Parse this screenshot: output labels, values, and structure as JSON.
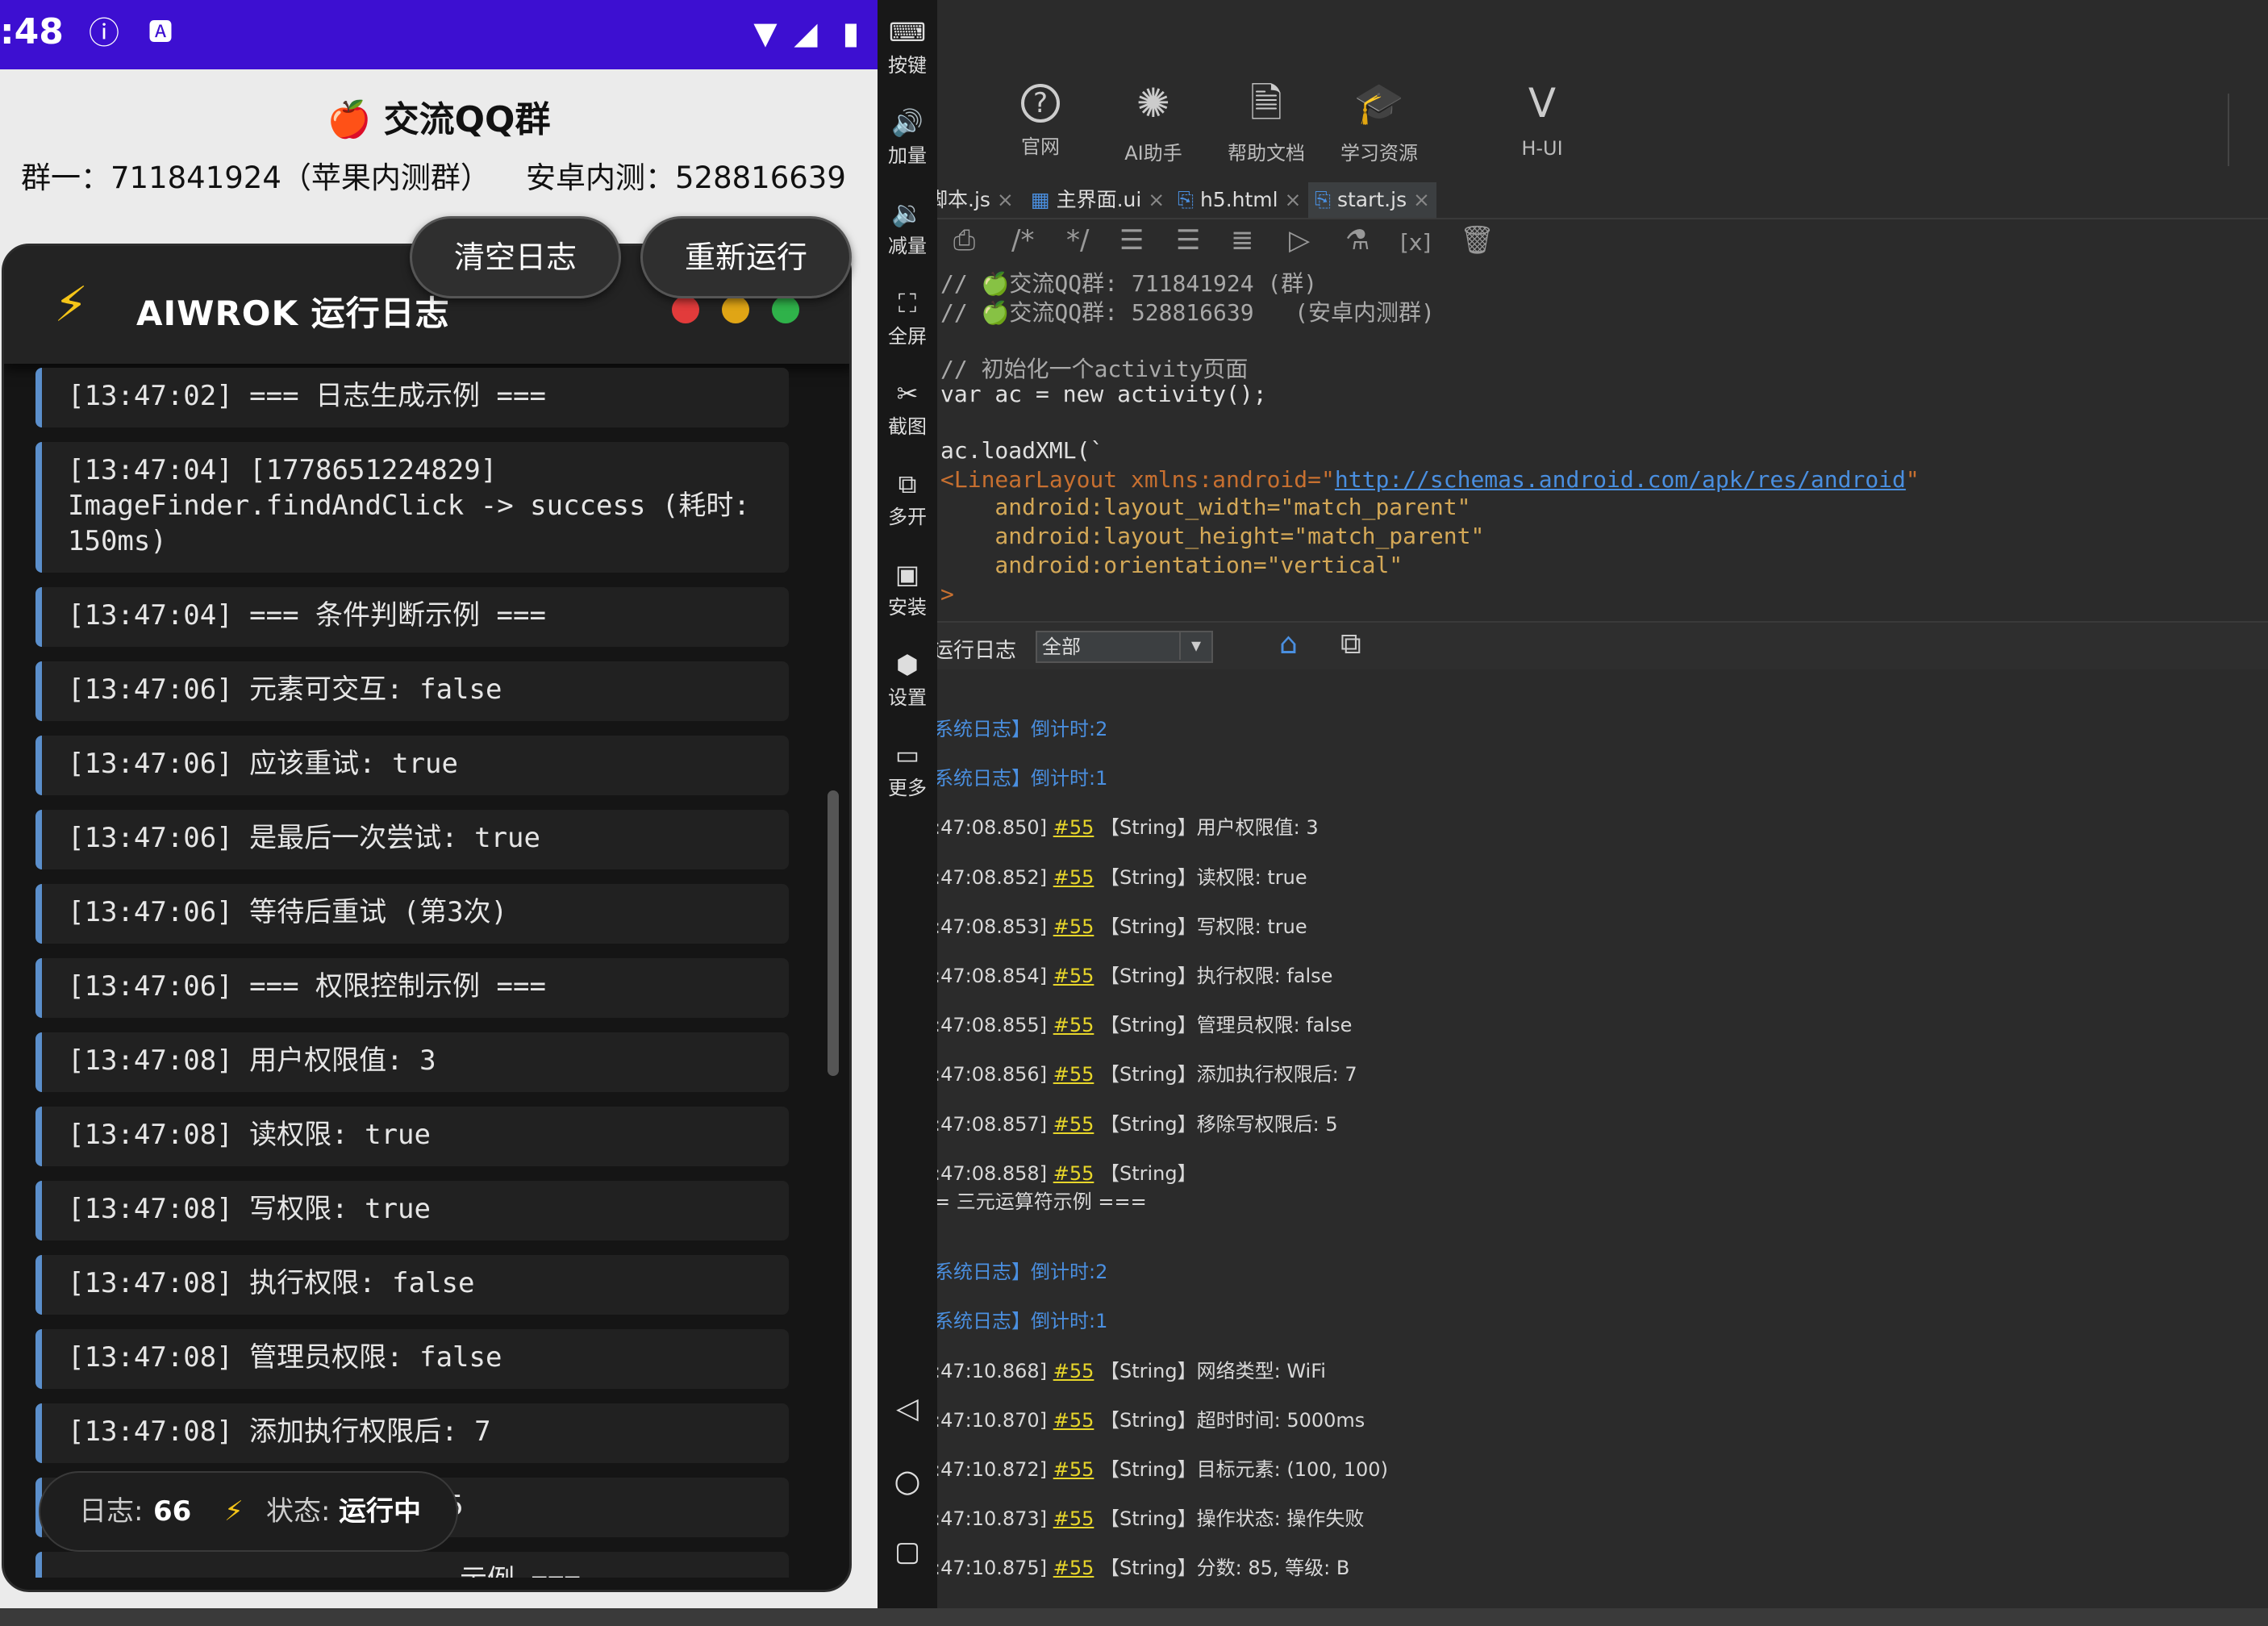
{
  "phone": {
    "status_time": ":48",
    "qq": {
      "title": "🍎 交流QQ群",
      "group1": "群一：711841924（苹果内测群）",
      "group2": "安卓内测：528816639"
    },
    "panel": {
      "title": "AIWROK 运行日志",
      "clear_label": "清空日志",
      "rerun_label": "重新运行"
    },
    "entries": [
      "[13:47:02] === 日志生成示例 ===",
      "[13:47:04] [1778651224829]\nImageFinder.findAndClick -> success (耗时:\n150ms)",
      "[13:47:04] === 条件判断示例 ===",
      "[13:47:06] 元素可交互: false",
      "[13:47:06] 应该重试: true",
      "[13:47:06] 是最后一次尝试: true",
      "[13:47:06] 等待后重试 (第3次)",
      "[13:47:06] === 权限控制示例 ===",
      "[13:47:08] 用户权限值: 3",
      "[13:47:08] 读权限: true",
      "[13:47:08] 写权限: true",
      "[13:47:08] 执行权限: false",
      "[13:47:08] 管理员权限: false",
      "[13:47:08] 添加执行权限后: 7",
      "[13:47:08] 移除写权限后: 5",
      "示例 ==="
    ],
    "footer": {
      "log_label": "日志:",
      "log_count": "66",
      "status_label": "状态:",
      "status_value": "运行中"
    }
  },
  "sidebar": [
    {
      "icon": "keyboard-icon",
      "label": "按键"
    },
    {
      "icon": "volume-up-icon",
      "label": "加量"
    },
    {
      "icon": "volume-down-icon",
      "label": "减量"
    },
    {
      "icon": "fullscreen-icon",
      "label": "全屏"
    },
    {
      "icon": "scissors-icon",
      "label": "截图"
    },
    {
      "icon": "multi-open-icon",
      "label": "多开"
    },
    {
      "icon": "apk-icon",
      "label": "安装"
    },
    {
      "icon": "settings-icon",
      "label": "设置"
    },
    {
      "icon": "more-icon",
      "label": "更多"
    }
  ],
  "toolbar": [
    {
      "icon": "help-circle-icon",
      "label": "官网"
    },
    {
      "icon": "ai-icon",
      "label": "AI助手"
    },
    {
      "icon": "document-icon",
      "label": "帮助文档"
    },
    {
      "icon": "graduation-cap-icon",
      "label": "学习资源"
    },
    {
      "icon": "vue-logo-icon",
      "label": "H-UI"
    }
  ],
  "tabs": [
    "脚本.js",
    "主界面.ui",
    "h5.html",
    "start.js"
  ],
  "code": [
    "// 🍏交流QQ群: 711841924 (群)",
    "// 🍏交流QQ群: 528816639   (安卓内测群)",
    "",
    "// 初始化一个activity页面",
    "var ac = new activity();",
    "",
    "ac.loadXML(`",
    "<LinearLayout xmlns:android=\"",
    "http://schemas.android.com/apk/res/android",
    "\"",
    "    android:layout_width=\"match_parent\"",
    "    android:layout_height=\"match_parent\"",
    "    android:orientation=\"vertical\"",
    ">"
  ],
  "logbar": {
    "label": "运行日志",
    "filter": "全部"
  },
  "log_lines": [
    {
      "kind": "sys",
      "text": "系统日志】倒计时:2"
    },
    {
      "kind": "sys",
      "text": "系统日志】倒计时:1"
    },
    {
      "kind": "msg",
      "time": ":47:08.850]",
      "tag": "#55",
      "text": "【String】用户权限值: 3"
    },
    {
      "kind": "msg",
      "time": ":47:08.852]",
      "tag": "#55",
      "text": "【String】读权限: true"
    },
    {
      "kind": "msg",
      "time": ":47:08.853]",
      "tag": "#55",
      "text": "【String】写权限: true"
    },
    {
      "kind": "msg",
      "time": ":47:08.854]",
      "tag": "#55",
      "text": "【String】执行权限: false"
    },
    {
      "kind": "msg",
      "time": ":47:08.855]",
      "tag": "#55",
      "text": "【String】管理员权限: false"
    },
    {
      "kind": "msg",
      "time": ":47:08.856]",
      "tag": "#55",
      "text": "【String】添加执行权限后: 7"
    },
    {
      "kind": "msg",
      "time": ":47:08.857]",
      "tag": "#55",
      "text": "【String】移除写权限后: 5"
    },
    {
      "kind": "msg",
      "time": ":47:08.858]",
      "tag": "#55",
      "text": "【String】"
    },
    {
      "kind": "cont",
      "text": "= 三元运算符示例 ==="
    },
    {
      "kind": "sys",
      "text": "系统日志】倒计时:2"
    },
    {
      "kind": "sys",
      "text": "系统日志】倒计时:1"
    },
    {
      "kind": "msg",
      "time": ":47:10.868]",
      "tag": "#55",
      "text": "【String】网络类型: WiFi"
    },
    {
      "kind": "msg",
      "time": ":47:10.870]",
      "tag": "#55",
      "text": "【String】超时时间: 5000ms"
    },
    {
      "kind": "msg",
      "time": ":47:10.872]",
      "tag": "#55",
      "text": "【String】目标元素: (100, 100)"
    },
    {
      "kind": "msg",
      "time": ":47:10.873]",
      "tag": "#55",
      "text": "【String】操作状态: 操作失败"
    },
    {
      "kind": "msg",
      "time": ":47:10.875]",
      "tag": "#55",
      "text": "【String】分数: 85, 等级: B"
    },
    {
      "kind": "msg",
      "time": ":47:10.876]",
      "tag": "#55",
      "text": "【String】"
    }
  ],
  "colors": {
    "status_bar": "#3d0fd1",
    "entry_accent": "#5b8fcc",
    "log_tag": "#e8d62a",
    "sys_log": "#4a8fe0"
  }
}
